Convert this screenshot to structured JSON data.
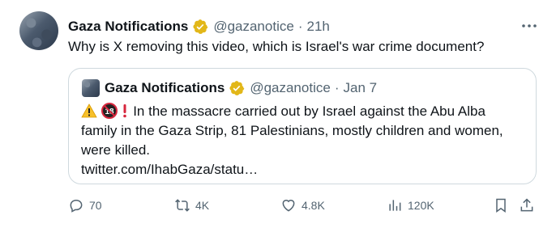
{
  "tweet": {
    "author_name": "Gaza Notifications",
    "handle": "@gazanotice",
    "separator": "·",
    "time": "21h",
    "text": "Why is X removing this video, which is Israel's war crime document?"
  },
  "quote": {
    "author_name": "Gaza Notifications",
    "handle": "@gazanotice",
    "separator": "·",
    "date": "Jan 7",
    "line1": "In the massacre carried out by Israel against the Abu Alba",
    "line2": "family in the Gaza Strip, 81 Palestinians, mostly children and women,",
    "line3": "were killed.",
    "link": "twitter.com/IhabGaza/statu…",
    "emoji_age": "18"
  },
  "actions": {
    "replies": "70",
    "reposts": "4K",
    "likes": "4.8K",
    "views": "120K"
  },
  "colors": {
    "verified_badge": "#e2b719",
    "secondary_text": "#536471",
    "border": "#cfd9de"
  },
  "icons": [
    "more-icon",
    "verified-badge-icon",
    "reply-icon",
    "repost-icon",
    "like-icon",
    "views-icon",
    "bookmark-icon",
    "share-icon"
  ]
}
